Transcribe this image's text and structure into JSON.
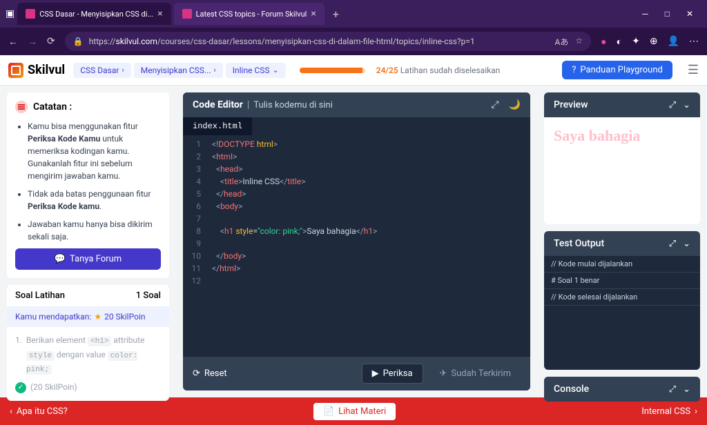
{
  "browser": {
    "tabs": [
      {
        "title": "CSS Dasar - Menyisipkan CSS di..."
      },
      {
        "title": "Latest CSS topics - Forum Skilvul"
      }
    ],
    "url_prefix": "https://",
    "url_domain": "skilvul.com",
    "url_path": "/courses/css-dasar/lessons/menyisipkan-css-di-dalam-file-html/topics/inline-css?p=1"
  },
  "header": {
    "logo": "Skilvul",
    "breadcrumbs": [
      "CSS Dasar",
      "Menyisipkan CSS...",
      "Inline CSS"
    ],
    "progress": "24/25",
    "progress_label": "Latihan sudah diselesaikan",
    "guide_btn": "Panduan Playground"
  },
  "catatan": {
    "title": "Catatan :",
    "items_html": [
      "Kamu bisa menggunakan fitur <b>Periksa Kode Kamu</b> untuk memeriksa kodingan kamu. Gunakanlah fitur ini sebelum mengirim jawaban kamu.",
      "Tidak ada batas penggunaan fitur <b>Periksa Kode kamu</b>.",
      "Jawaban kamu hanya bisa dikirim sekali saja."
    ],
    "tanya_btn": "Tanya Forum"
  },
  "soal": {
    "header": "Soal Latihan",
    "count": "1 Soal",
    "skilpoin_prefix": "Kamu mendapatkan:",
    "skilpoin_value": "20 SkilPoin",
    "item_num": "1.",
    "item_text1": "Berikan element",
    "item_code1": "<h1>",
    "item_text2": "attribute",
    "item_code2": "style",
    "item_text3": "dengan value",
    "item_code3": "color: pink;",
    "item_points": "(20 SkilPoin)"
  },
  "editor": {
    "title": "Code Editor",
    "subtitle": "Tulis kodemu di sini",
    "filename": "index.html",
    "reset": "Reset",
    "periksa": "Periksa",
    "terkirim": "Sudah Terkirim",
    "lines": 12
  },
  "preview": {
    "title": "Preview",
    "content": "Saya bahagia"
  },
  "test_output": {
    "title": "Test Output",
    "lines": [
      "// Kode mulai dijalankan",
      "# Soal 1 benar",
      "// Kode selesai dijalankan"
    ]
  },
  "console": {
    "title": "Console"
  },
  "footer": {
    "prev": "Apa itu CSS?",
    "center": "Lihat Materi",
    "next": "Internal CSS"
  }
}
